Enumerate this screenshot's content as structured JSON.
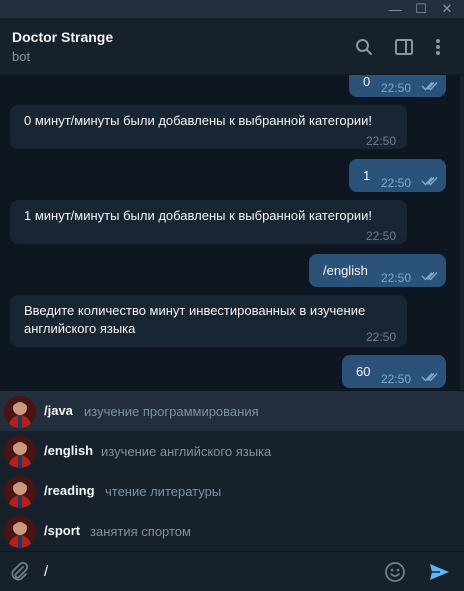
{
  "window": {
    "minimize": "—",
    "maximize": "☐",
    "close": "✕"
  },
  "header": {
    "name": "Doctor Strange",
    "status": "bot"
  },
  "messages": [
    {
      "dir": "out",
      "text": "0",
      "time": "22:50"
    },
    {
      "dir": "in",
      "text": "0 минут/минуты были добавлены к выбранной категории!",
      "time": "22:50"
    },
    {
      "dir": "out",
      "text": "1",
      "time": "22:50"
    },
    {
      "dir": "in",
      "text": "1 минут/минуты были добавлены к выбранной категории!",
      "time": "22:50"
    },
    {
      "dir": "out",
      "text": "/english",
      "time": "22:50"
    },
    {
      "dir": "in",
      "line1": "Введите количество минут инвестированных в изучение",
      "line2": "английского языка",
      "time": "22:50"
    },
    {
      "dir": "out",
      "text": "60",
      "time": "22:50"
    }
  ],
  "suggestions": [
    {
      "cmd": "/java",
      "desc": "изучение программирования"
    },
    {
      "cmd": "/english",
      "desc": "изучение английского языка"
    },
    {
      "cmd": "/reading",
      "desc": "чтение литературы"
    },
    {
      "cmd": "/sport",
      "desc": "занятия спортом"
    }
  ],
  "composer": {
    "value": "/"
  },
  "colors": {
    "bg": "#0e1621",
    "incoming": "#182533",
    "outgoing": "#2b5278",
    "accent": "#5eb5f7"
  }
}
